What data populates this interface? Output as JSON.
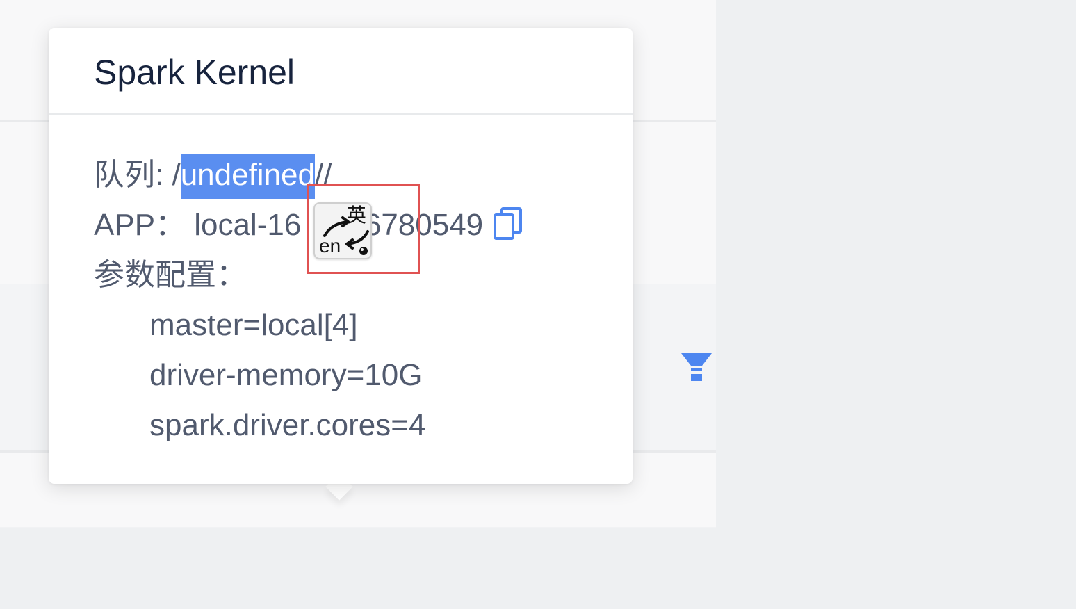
{
  "popover": {
    "title": "Spark Kernel",
    "queue_label": "队列: /",
    "queue_selected": "undefined",
    "queue_suffix": "//",
    "app_label": "APP：",
    "app_value": "local-16",
    "app_value_tail": "46780549",
    "params_label": "参数配置：",
    "params": [
      "master=local[4]",
      "driver-memory=10G",
      "spark.driver.cores=4"
    ]
  },
  "translate_button": {
    "top_glyph": "英",
    "bottom_text": "en"
  },
  "icons": {
    "copy": "copy-icon",
    "filter": "filter-icon",
    "translate": "translate-icon"
  },
  "colors": {
    "accent": "#4d86f0",
    "selection": "#5a8ef0",
    "highlight_border": "#e05252"
  }
}
